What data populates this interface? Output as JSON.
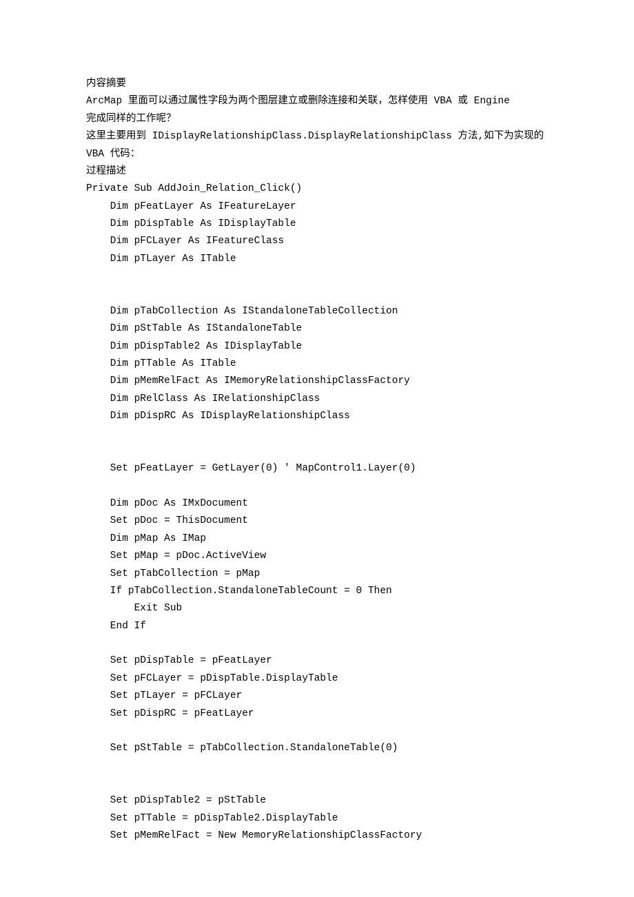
{
  "lines": [
    {
      "text": "内容摘要",
      "indent": 0
    },
    {
      "text": "ArcMap 里面可以通过属性字段为两个图层建立或删除连接和关联，怎样使用 VBA 或 Engine",
      "indent": 0
    },
    {
      "text": "完成同样的工作呢？",
      "indent": 0
    },
    {
      "text": "这里主要用到 IDisplayRelationshipClass.DisplayRelationshipClass 方法,如下为实现的",
      "indent": 0
    },
    {
      "text": "VBA 代码：",
      "indent": 0
    },
    {
      "text": "过程描述",
      "indent": 0
    },
    {
      "text": "Private Sub AddJoin_Relation_Click()",
      "indent": 0
    },
    {
      "text": "Dim pFeatLayer As IFeatureLayer",
      "indent": 1
    },
    {
      "text": "Dim pDispTable As IDisplayTable",
      "indent": 1
    },
    {
      "text": "Dim pFCLayer As IFeatureClass",
      "indent": 1
    },
    {
      "text": "Dim pTLayer As ITable",
      "indent": 1
    },
    {
      "blank": true
    },
    {
      "blank": true
    },
    {
      "text": "Dim pTabCollection As IStandaloneTableCollection",
      "indent": 1
    },
    {
      "text": "Dim pStTable As IStandaloneTable",
      "indent": 1
    },
    {
      "text": "Dim pDispTable2 As IDisplayTable",
      "indent": 1
    },
    {
      "text": "Dim pTTable As ITable",
      "indent": 1
    },
    {
      "text": "Dim pMemRelFact As IMemoryRelationshipClassFactory",
      "indent": 1
    },
    {
      "text": "Dim pRelClass As IRelationshipClass",
      "indent": 1
    },
    {
      "text": "Dim pDispRC As IDisplayRelationshipClass",
      "indent": 1
    },
    {
      "blank": true
    },
    {
      "blank": true
    },
    {
      "text": "Set pFeatLayer = GetLayer(0) ' MapControl1.Layer(0)",
      "indent": 1
    },
    {
      "blank": true
    },
    {
      "text": "Dim pDoc As IMxDocument",
      "indent": 1
    },
    {
      "text": "Set pDoc = ThisDocument",
      "indent": 1
    },
    {
      "text": "Dim pMap As IMap",
      "indent": 1
    },
    {
      "text": "Set pMap = pDoc.ActiveView",
      "indent": 1
    },
    {
      "text": "Set pTabCollection = pMap",
      "indent": 1
    },
    {
      "text": "If pTabCollection.StandaloneTableCount = 0 Then",
      "indent": 1
    },
    {
      "text": "Exit Sub",
      "indent": 2
    },
    {
      "text": "End If",
      "indent": 1
    },
    {
      "blank": true
    },
    {
      "text": "Set pDispTable = pFeatLayer",
      "indent": 1
    },
    {
      "text": "Set pFCLayer = pDispTable.DisplayTable",
      "indent": 1
    },
    {
      "text": "Set pTLayer = pFCLayer",
      "indent": 1
    },
    {
      "text": "Set pDispRC = pFeatLayer",
      "indent": 1
    },
    {
      "blank": true
    },
    {
      "text": "Set pStTable = pTabCollection.StandaloneTable(0)",
      "indent": 1
    },
    {
      "blank": true
    },
    {
      "blank": true
    },
    {
      "text": "Set pDispTable2 = pStTable",
      "indent": 1
    },
    {
      "text": "Set pTTable = pDispTable2.DisplayTable",
      "indent": 1
    },
    {
      "text": "Set pMemRelFact = New MemoryRelationshipClassFactory",
      "indent": 1
    }
  ]
}
